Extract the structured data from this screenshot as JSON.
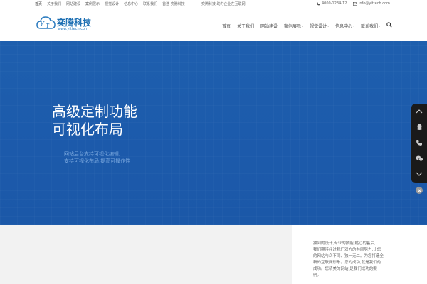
{
  "topbar": {
    "nav": [
      "首页",
      "关于我们",
      "网站建设",
      "案例展示",
      "视觉设计",
      "信息中心",
      "联系我们",
      "首选 奕腾科技"
    ],
    "slogan": "奕腾科技:助力企业在互联网",
    "phone": "4000-1234-12",
    "email": "info@yittech.com"
  },
  "header": {
    "logo_cn": "奕腾科技",
    "logo_en": "www.yittech.com",
    "nav": [
      {
        "label": "首页",
        "dropdown": false
      },
      {
        "label": "关于我们",
        "dropdown": false
      },
      {
        "label": "网站建设",
        "dropdown": false
      },
      {
        "label": "案例展示",
        "dropdown": true
      },
      {
        "label": "视觉设计",
        "dropdown": true
      },
      {
        "label": "信息中心",
        "dropdown": true
      },
      {
        "label": "联系我们",
        "dropdown": true
      }
    ]
  },
  "hero": {
    "title_line1": "高级定制功能",
    "title_line2": "可视化布局",
    "sub_line1": "网站后台支持可视化编辑,",
    "sub_line2": "支持可视化布局,提高可操作性"
  },
  "bottom": {
    "lines": [
      "独到的设计,专业的技能,贴心的售后,",
      "我们期待经过我们双方的共同努力,让您",
      "的网站与众不同、独一无二。为您打造全",
      "新的互联网形象。您的成功,就是我们的",
      "成功。您精美的网站,是我们成功的案",
      "例。"
    ]
  },
  "colors": {
    "brand": "#1d6fb3",
    "hero_bg": "#1e5fae",
    "sidebar_bg": "#1a1a1a"
  }
}
